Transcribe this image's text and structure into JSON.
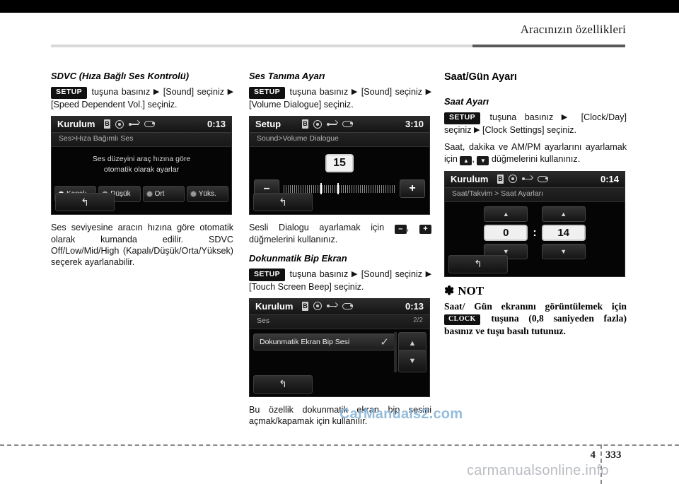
{
  "header": {
    "title": "Aracınızın özellikleri"
  },
  "footer": {
    "chapter": "4",
    "page": "333",
    "watermark_bottom": "carmanualsonline.info",
    "watermark_mid": "CarManuals2.com"
  },
  "col1": {
    "heading": "SDVC (Hıza Bağlı Ses Kontrolü)",
    "key": "SETUP",
    "instruction_1": "tuşuna basınız",
    "instruction_2": "[Sound] seçiniz",
    "instruction_3": "[Speed Dependent Vol.] seçiniz.",
    "paragraph": "Ses seviyesine aracın hızına göre otomatik olarak kumanda edilir. SDVC Off/Low/Mid/High (Kapalı/Düşük/Orta/Yüksek) seçerek ayarlanabilir.",
    "screen": {
      "title": "Kurulum",
      "clock": "0:13",
      "breadcrumb": "Ses>Hıza Bağımlı Ses",
      "message_line1": "Ses düzeyini araç hızına göre",
      "message_line2": "otomatik olarak ayarlar",
      "options": [
        {
          "label": "Kapalı",
          "selected": true
        },
        {
          "label": "Düşük",
          "selected": false
        },
        {
          "label": "Ort",
          "selected": false
        },
        {
          "label": "Yüks.",
          "selected": false
        }
      ],
      "back_icon": "↰"
    }
  },
  "col2": {
    "heading_1": "Ses Tanıma Ayarı",
    "key": "SETUP",
    "instruction_1": "tuşuna basınız",
    "instruction_2": "[Sound] seçiniz",
    "instruction_3": "[Volume Dialogue] seçiniz.",
    "screen_volume": {
      "title": "Setup",
      "clock": "3:10",
      "breadcrumb": "Sound>Volume Dialogue",
      "value": "15",
      "minus": "–",
      "plus": "+",
      "back_icon": "↰"
    },
    "paragraph_1a": "Sesli Dialogu ayarlamak için",
    "paragraph_1b": ",",
    "paragraph_1c": "düğmelerini kullanınız.",
    "heading_2": "Dokunmatik Bip Ekran",
    "instruction_4": "tuşuna basınız",
    "instruction_5": "[Sound] seçiniz",
    "instruction_6": "[Touch Screen Beep] seçiniz.",
    "screen_beep": {
      "title": "Kurulum",
      "clock": "0:13",
      "breadcrumb": "Ses",
      "pageindicator": "2/2",
      "item_label": "Dokunmatik Ekran Bip Sesi",
      "check": "✓",
      "scroll_up": "▲",
      "scroll_down": "▼",
      "back_icon": "↰"
    },
    "paragraph_2": "Bu özellik dokunmatik ekran bip sesini açmak/kapamak için kullanılır."
  },
  "col3": {
    "heading_1": "Saat/Gün Ayarı",
    "heading_2": "Saat Ayarı",
    "key": "SETUP",
    "instruction_1": "tuşuna basınız",
    "instruction_2": "[Clock/Day] seçiniz",
    "instruction_3": "[Clock Settings] seçiniz.",
    "paragraph_1a": "Saat, dakika ve AM/PM ayarlarını ayarlamak için",
    "paragraph_1b": ",",
    "paragraph_1c": "düğmelerini kullanınız.",
    "screen_clock": {
      "title": "Kurulum",
      "clock": "0:14",
      "breadcrumb": "Saat/Takvim > Saat Ayarları",
      "hour": "0",
      "minute": "14",
      "separator": ":",
      "up": "▲",
      "down": "▼",
      "back_icon": "↰"
    },
    "note_star": "✽",
    "note_title": "NOT",
    "note_body": "Saat/ Gün ekranını görüntülemek için",
    "note_key": "CLOCK",
    "note_body_2": "tuşuna (0,8 saniyeden fazla) basınız ve tuşu basılı tutunuz."
  }
}
